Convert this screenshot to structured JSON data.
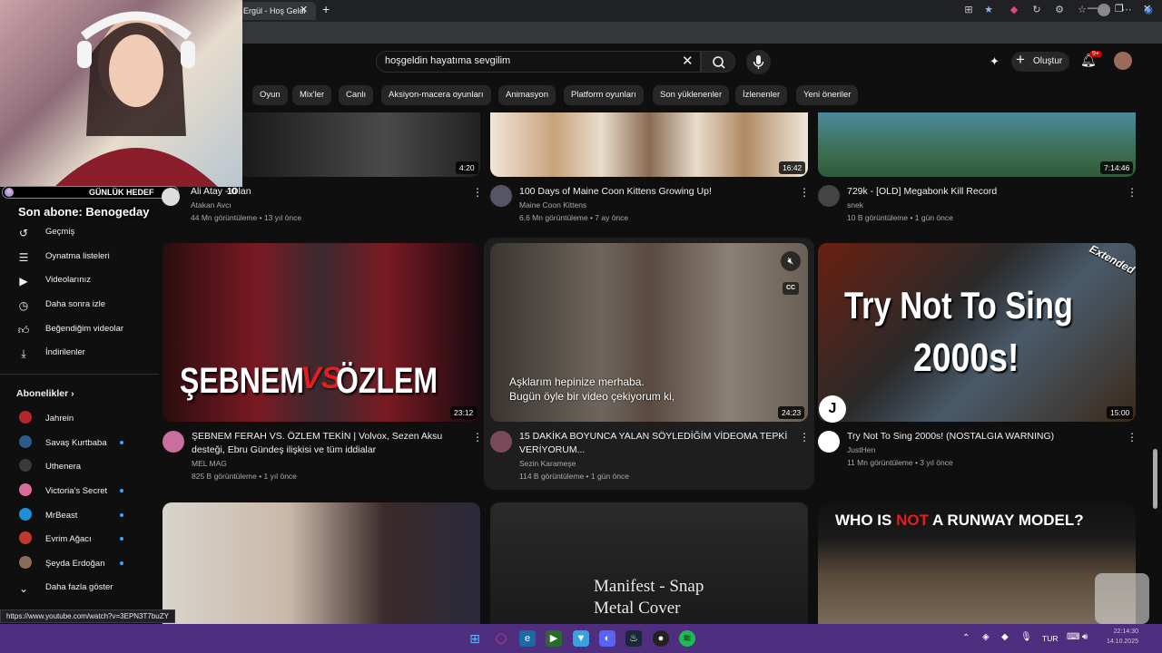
{
  "browser": {
    "tab_title": "Ergül - Hoş Geldi",
    "tab_close": "✕",
    "new_tab": "+",
    "window_controls": [
      "—",
      "❐",
      "✕"
    ]
  },
  "search": {
    "query": "hoşgeldin hayatıma sevgilim",
    "clear_icon": "close-icon",
    "search_icon": "search-icon",
    "mic_icon": "mic-icon"
  },
  "header": {
    "create_label": "Oluştur",
    "notification_count": "9+"
  },
  "chips": [
    "Oyun",
    "Mix'ler",
    "Canlı",
    "Aksiyon-macera oyunları",
    "Animasyon",
    "Platform oyunları",
    "Son yüklenenler",
    "İzlenenler",
    "Yeni öneriler"
  ],
  "sidebar": {
    "items": [
      {
        "label": "Geçmiş",
        "icon": "history-icon"
      },
      {
        "label": "Oynatma listeleri",
        "icon": "playlist-icon"
      },
      {
        "label": "Videolarınız",
        "icon": "video-icon"
      },
      {
        "label": "Daha sonra izle",
        "icon": "clock-icon"
      },
      {
        "label": "Beğendiğim videolar",
        "icon": "thumbs-up-icon"
      },
      {
        "label": "İndirilenler",
        "icon": "download-icon"
      }
    ],
    "subs_heading": "Abonelikler",
    "subscriptions": [
      {
        "name": "Jahrein",
        "color": "#b3262c",
        "live": false
      },
      {
        "name": "Savaş Kurtbaba",
        "color": "#2a5c8a",
        "live": true
      },
      {
        "name": "Uthenera",
        "color": "#3a3a3a",
        "live": false
      },
      {
        "name": "Victoria's Secret",
        "color": "#d96c9c",
        "live": true
      },
      {
        "name": "MrBeast",
        "color": "#1d8fd6",
        "live": true
      },
      {
        "name": "Evrim Ağacı",
        "color": "#c0392b",
        "live": true
      },
      {
        "name": "Şeyda Erdoğan",
        "color": "#8a6a5a",
        "live": true
      }
    ],
    "show_more": "Daha fazla göster"
  },
  "videos_row1": [
    {
      "title": "Ali Atay - Ölan",
      "channel": "Atakan Avcı",
      "meta": "44 Mn görüntüleme • 13 yıl önce",
      "duration": "4:20"
    },
    {
      "title": "100 Days of Maine Coon Kittens Growing Up!",
      "channel": "Maine Coon Kittens",
      "meta": "6,6 Mn görüntüleme • 7 ay önce",
      "duration": "16:42"
    },
    {
      "title": "729k - [OLD] Megabonk Kill Record",
      "channel": "snek",
      "meta": "10 B görüntüleme • 1 gün önce",
      "duration": "7:14:46"
    }
  ],
  "videos_row2": [
    {
      "title": "ŞEBNEM FERAH VS. ÖZLEM TEKİN | Volvox, Sezen Aksu desteği, Ebru Gündeş ilişkisi ve tüm iddialar",
      "channel": "MEL MAG",
      "meta": "825 B görüntüleme • 1 yıl önce",
      "duration": "23:12",
      "thumb_text_left": "ŞEBNEM",
      "thumb_text_vs": "VS",
      "thumb_text_right": "ÖZLEM"
    },
    {
      "title": "15 DAKİKA BOYUNCA YALAN SÖYLEDİĞİM VİDEOMA TEPKİ VERİYORUM...",
      "channel": "Sezin Karameşe",
      "meta": "114 B görüntüleme • 1 gün önce",
      "duration": "24:23",
      "caption_line1": "Aşklarım hepinize merhaba.",
      "caption_line2": "Bugün öyle bir video çekiyorum ki,"
    },
    {
      "title": "Try Not To Sing 2000s! (NOSTALGIA WARNING)",
      "channel": "JustHen",
      "meta": "11 Mn görüntüleme • 3 yıl önce",
      "duration": "15:00",
      "thumb_text_1": "Try Not To Sing",
      "thumb_text_2": "2000s!",
      "thumb_badge": "Extended"
    }
  ],
  "videos_row3": [
    {
      "thumb_text": ""
    },
    {
      "thumb_text_1": "Manifest - Snap",
      "thumb_text_2": "Metal Cover"
    },
    {
      "thumb_text_a": "WHO IS ",
      "thumb_text_b": "NOT",
      "thumb_text_c": " A RUNWAY MODEL?"
    }
  ],
  "overlay": {
    "goal_label": "GÜNLÜK HEDEF",
    "goal_count": "10",
    "goal_start": "0",
    "last_sub": "Son abone: Benogeday"
  },
  "status_url": "https://www.youtube.com/watch?v=3EPN3T7buZY",
  "taskbar": {
    "lang": "TUR",
    "time": "22:14:30",
    "date": "14.10.2025"
  }
}
